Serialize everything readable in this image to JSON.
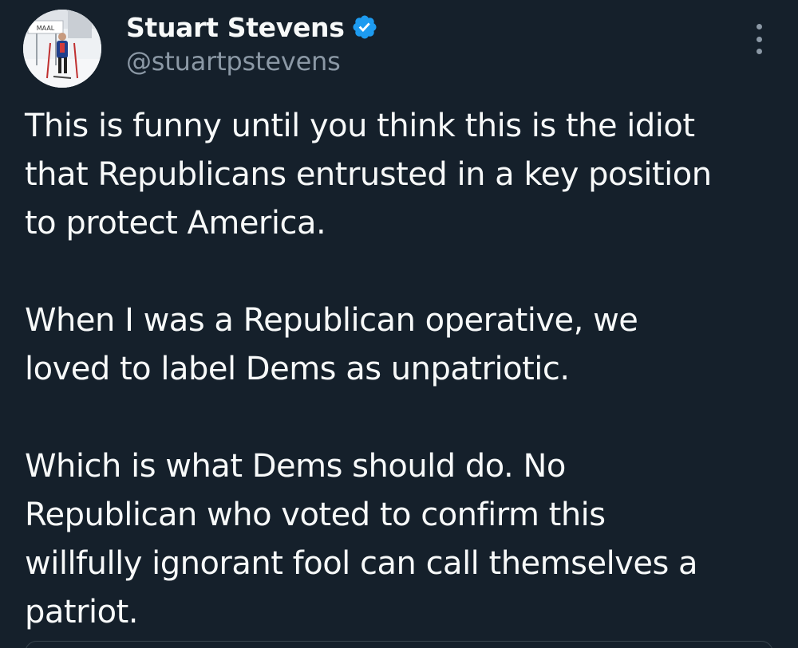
{
  "author": {
    "display_name": "Stuart Stevens",
    "handle": "@stuartpstevens",
    "avatar_sign_text": "MAAL",
    "verified": true
  },
  "tweet": {
    "paragraphs": [
      "This is funny until you think this is the idiot\nthat Republicans entrusted in a key position\nto protect America.",
      "When I was a Republican operative, we\nloved to label Dems as unpatriotic.",
      "Which is what Dems should do. No\nRepublican who voted to confirm this\nwillfully ignorant fool can call themselves a\npatriot."
    ]
  },
  "icons": {
    "verified": "verified-badge-icon",
    "more": "more-options-icon"
  },
  "colors": {
    "background": "#15202b",
    "text": "#f7f9f9",
    "secondary_text": "#8b98a5",
    "verified_blue": "#1d9bf0",
    "border": "#38444d"
  }
}
